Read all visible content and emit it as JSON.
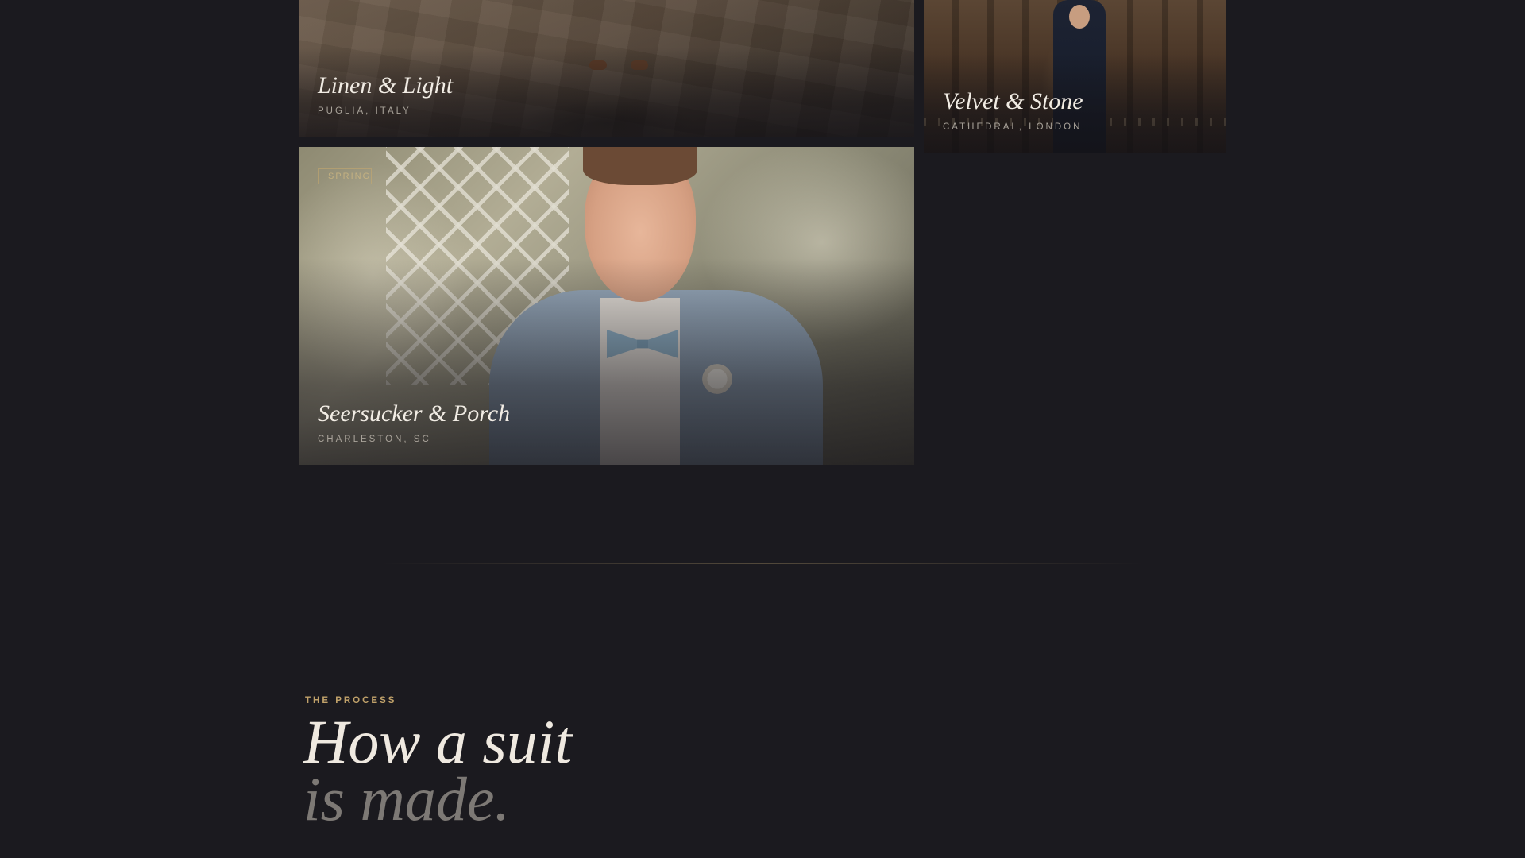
{
  "gallery": {
    "cards": [
      {
        "title": "Linen & Light",
        "location": "PUGLIA, ITALY"
      },
      {
        "title": "Velvet & Stone",
        "location": "CATHEDRAL, LONDON"
      },
      {
        "title": "Seersucker & Porch",
        "location": "CHARLESTON, SC",
        "tag": "SPRING"
      }
    ]
  },
  "process": {
    "eyebrow": "THE PROCESS",
    "heading_line1": "How a suit",
    "heading_line2": "is made."
  },
  "colors": {
    "background": "#1b1a1f",
    "accent_gold": "#c1a26a",
    "heading_light": "#efe9e0",
    "heading_muted": "#7d7975"
  }
}
